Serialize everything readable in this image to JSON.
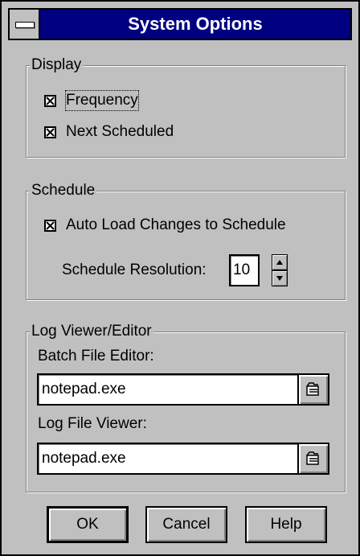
{
  "window": {
    "title": "System Options"
  },
  "display": {
    "label": "Display",
    "frequency": {
      "label": "Frequency",
      "checked": true
    },
    "next_scheduled": {
      "label": "Next Scheduled",
      "checked": true
    }
  },
  "schedule": {
    "label": "Schedule",
    "auto_load": {
      "label": "Auto Load Changes to Schedule",
      "checked": true
    },
    "resolution_label": "Schedule Resolution:",
    "resolution_value": "10"
  },
  "log_viewer": {
    "label": "Log Viewer/Editor",
    "batch_editor_label": "Batch File Editor:",
    "batch_editor_value": "notepad.exe",
    "log_viewer_label": "Log File Viewer:",
    "log_viewer_value": "notepad.exe"
  },
  "buttons": {
    "ok": "OK",
    "cancel": "Cancel",
    "help": "Help"
  },
  "colors": {
    "face": "#c0c0c0",
    "title_bar": "#000080",
    "shadow": "#808080"
  },
  "icons": [
    "system-menu-icon",
    "checkbox-x-icon",
    "spin-up-icon",
    "spin-down-icon",
    "folder-browse-icon"
  ]
}
